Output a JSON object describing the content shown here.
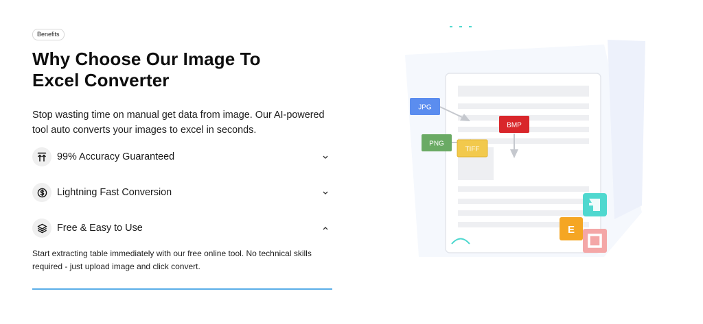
{
  "section": {
    "badge": "Benefits",
    "title": "Why Choose Our Image To Excel Converter",
    "description": "Stop wasting time on manual get data from image. Our AI-powered tool auto converts your images to excel in seconds."
  },
  "accordion": {
    "items": [
      {
        "label": "99% Accuracy Guaranteed",
        "icon": "arrows-up-icon",
        "expanded": false
      },
      {
        "label": "Lightning Fast Conversion",
        "icon": "dollar-circle-icon",
        "expanded": false
      },
      {
        "label": "Free & Easy to Use",
        "icon": "layers-icon",
        "expanded": true,
        "body": "Start extracting table immediately with our free online tool. No technical skills required - just upload image and click convert."
      }
    ]
  },
  "illustration": {
    "formats": [
      "JPG",
      "BMP",
      "PNG",
      "TIFF"
    ],
    "tiles": [
      "E"
    ],
    "colors": {
      "jpg": "#5b8def",
      "bmp": "#d9262b",
      "png": "#6aaa64",
      "tiff": "#f2c94c",
      "teal": "#4fd8cf",
      "orange": "#f5a623",
      "pink": "#f4a7a7",
      "accent": "#5aaee8"
    }
  }
}
